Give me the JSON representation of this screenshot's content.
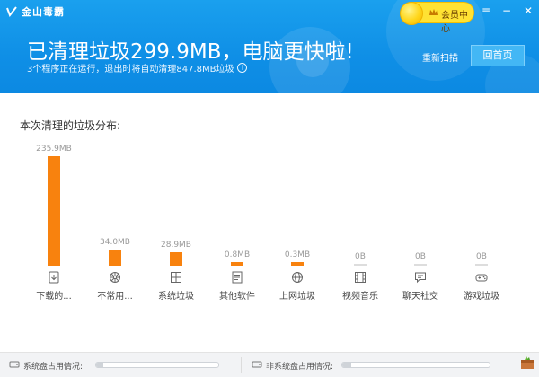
{
  "app": {
    "name": "金山毒霸"
  },
  "header": {
    "vip_label": "会员中心",
    "headline": "已清理垃圾299.9MB，电脑更快啦!",
    "subline": "3个程序正在运行，退出时将自动清理847.8MB垃圾",
    "rescan_label": "重新扫描",
    "home_label": "回首页",
    "window_controls": {
      "menu": "≡",
      "minimize": "−",
      "close": "✕"
    }
  },
  "section_title": "本次清理的垃圾分布:",
  "chart_data": {
    "type": "bar",
    "title": "本次清理的垃圾分布:",
    "categories": [
      "下载的...",
      "不常用...",
      "系统垃圾",
      "其他软件",
      "上网垃圾",
      "视频音乐",
      "聊天社交",
      "游戏垃圾"
    ],
    "values": [
      235.9,
      34.0,
      28.9,
      0.8,
      0.3,
      0,
      0,
      0
    ],
    "value_labels": [
      "235.9MB",
      "34.0MB",
      "28.9MB",
      "0.8MB",
      "0.3MB",
      "0B",
      "0B",
      "0B"
    ],
    "unit": "MB",
    "icons": [
      "download-icon",
      "gear-wheel-icon",
      "windows-icon",
      "software-icon",
      "globe-icon",
      "film-icon",
      "chat-icon",
      "gamepad-icon"
    ],
    "bar_color": "#f8820e",
    "empty_color": "#dddddd"
  },
  "footer": {
    "system_disk_label": "系统盘占用情况:",
    "system_disk_usage": 0.06,
    "other_disk_label": "非系统盘占用情况:",
    "other_disk_usage": 0.06
  },
  "colors": {
    "header": "#0f8fe6",
    "accent": "#f8820e",
    "vip": "#ffe233"
  }
}
